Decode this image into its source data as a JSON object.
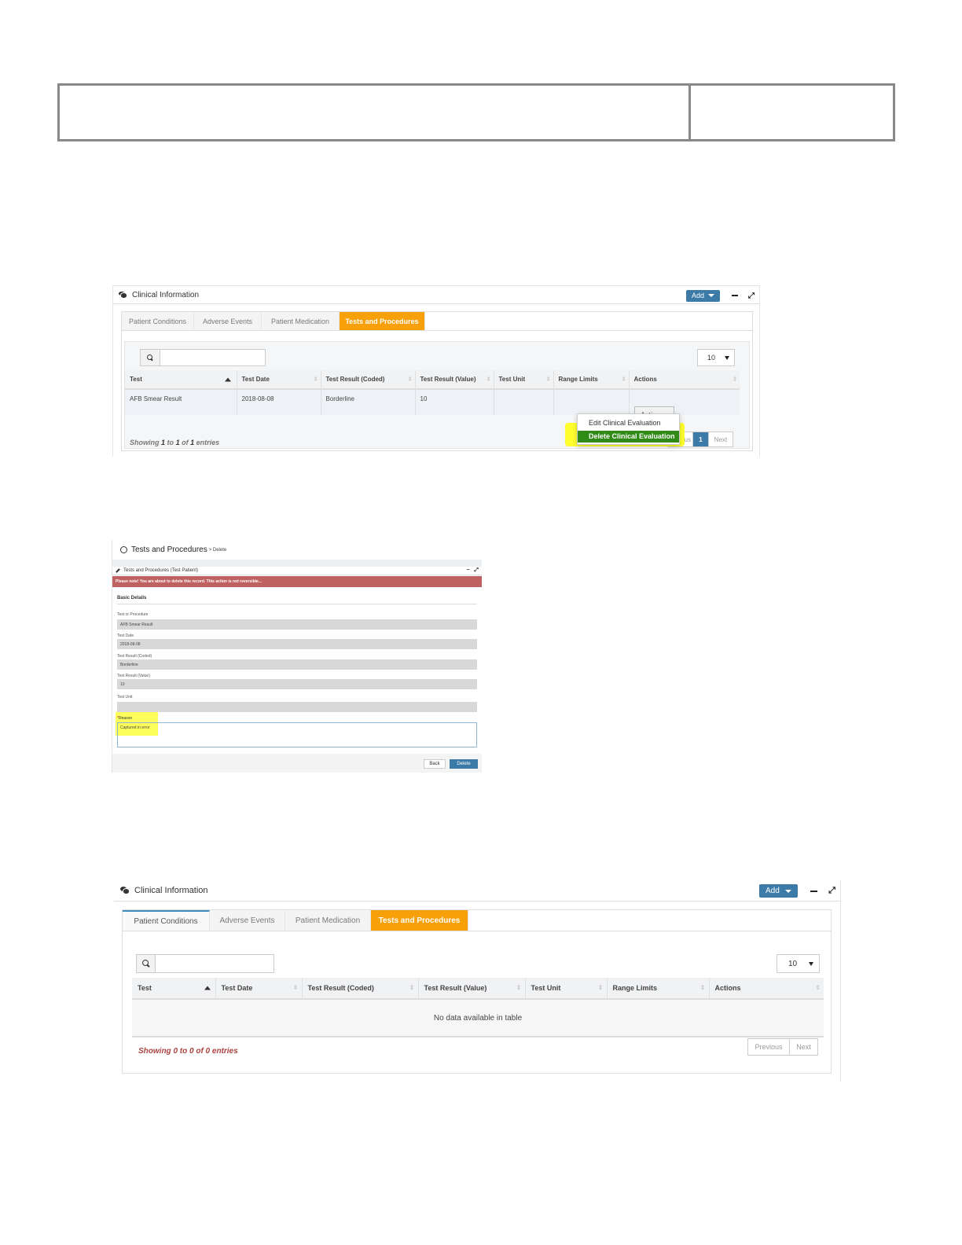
{
  "panel1": {
    "title": "Clinical Information",
    "add_label": "Add",
    "tabs": [
      "Patient Conditions",
      "Adverse Events",
      "Patient Medication",
      "Tests and Procedures"
    ],
    "length_value": "10",
    "columns": [
      "Test",
      "Test Date",
      "Test Result (Coded)",
      "Test Result (Value)",
      "Test Unit",
      "Range Limits",
      "Actions"
    ],
    "row": {
      "test": "AFB Smear Result",
      "test_date": "2018-08-08",
      "coded": "Borderline",
      "value": "10",
      "unit": "",
      "range": ""
    },
    "action_label": "Action",
    "dropdown": [
      "Edit Clinical Evaluation",
      "Delete Clinical Evaluation"
    ],
    "showing": {
      "pre": "Showing",
      "from": "1",
      "to_word": "to",
      "to": "1",
      "of_word": "of",
      "total": "1",
      "post": "entries"
    },
    "pager": {
      "prev": "vious",
      "current": "1",
      "next": "Next"
    }
  },
  "form": {
    "title": "Tests and Procedures",
    "crumb": "> Delete",
    "panel_title": "Tests and Procedures (Test Patient)",
    "alert": "Please note! You are about to delete this record. This action is not reversible...",
    "section": "Basic Details",
    "fields": [
      {
        "label": "Test or Procedure",
        "value": "AFB Smear Result"
      },
      {
        "label": "Test Date",
        "value": "2018-08-08"
      },
      {
        "label": "Test Result (Coded)",
        "value": "Borderline"
      },
      {
        "label": "Test Result (Value)",
        "value": "10"
      },
      {
        "label": "Test Unit",
        "value": ""
      }
    ],
    "reason_label": "Reason",
    "reason_value": "Captured in error",
    "back_label": "Back",
    "delete_label": "Delete"
  },
  "panel2": {
    "title": "Clinical Information",
    "add_label": "Add",
    "tabs": [
      "Patient Conditions",
      "Adverse Events",
      "Patient Medication",
      "Tests and Procedures"
    ],
    "length_value": "10",
    "columns": [
      "Test",
      "Test Date",
      "Test Result (Coded)",
      "Test Result (Value)",
      "Test Unit",
      "Range Limits",
      "Actions"
    ],
    "empty_text": "No data available in table",
    "showing": "Showing 0 to 0 of 0 entries",
    "pager": {
      "prev": "Previous",
      "next": "Next"
    }
  },
  "colors": {
    "accent_blue": "#3c7aa8",
    "tab_orange": "#f7a00a",
    "alert_red": "#c06060",
    "highlight_yellow": "#ffff2e",
    "menu_green": "#2f8a16"
  }
}
